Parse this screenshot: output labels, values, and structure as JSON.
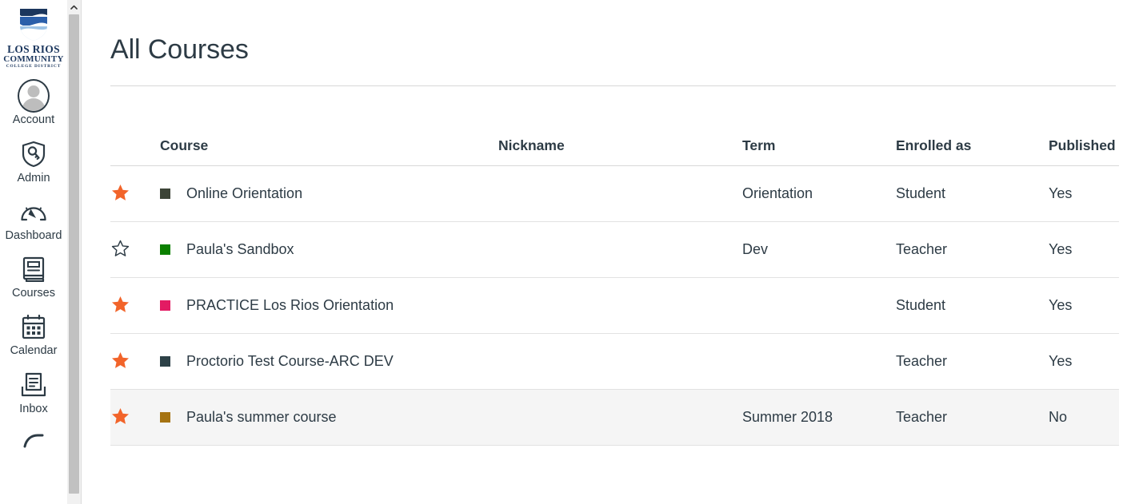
{
  "brand": {
    "logo_line1": "LOS RIOS",
    "logo_line2": "COMMUNITY",
    "logo_line3": "COLLEGE DISTRICT",
    "logo_color": "#1b365d"
  },
  "nav": {
    "items": [
      {
        "label": "Account",
        "icon": "account-avatar-icon"
      },
      {
        "label": "Admin",
        "icon": "shield-key-icon"
      },
      {
        "label": "Dashboard",
        "icon": "dashboard-gauge-icon"
      },
      {
        "label": "Courses",
        "icon": "book-icon"
      },
      {
        "label": "Calendar",
        "icon": "calendar-icon"
      },
      {
        "label": "Inbox",
        "icon": "inbox-tray-icon"
      }
    ]
  },
  "scrollbar": {
    "up_arrow_icon": "chevron-up-icon"
  },
  "page": {
    "title": "All Courses"
  },
  "table": {
    "columns": [
      "",
      "Course",
      "Nickname",
      "Term",
      "Enrolled as",
      "Published"
    ],
    "rows": [
      {
        "favorite": true,
        "star_icon": "star-filled-icon",
        "swatch_color": "#3c4437",
        "course": "Online Orientation",
        "nickname": "",
        "term": "Orientation",
        "enrolled_as": "Student",
        "published": "Yes",
        "published_state": "yes",
        "hover": false
      },
      {
        "favorite": false,
        "star_icon": "star-outline-icon",
        "swatch_color": "#0b8000",
        "course": "Paula's Sandbox",
        "nickname": "",
        "term": "Dev",
        "enrolled_as": "Teacher",
        "published": "Yes",
        "published_state": "yes",
        "hover": false
      },
      {
        "favorite": true,
        "star_icon": "star-filled-icon",
        "swatch_color": "#e31b63",
        "course": "PRACTICE Los Rios Orientation",
        "nickname": "",
        "term": "",
        "enrolled_as": "Student",
        "published": "Yes",
        "published_state": "yes",
        "hover": false
      },
      {
        "favorite": true,
        "star_icon": "star-filled-icon",
        "swatch_color": "#2d4147",
        "course": "Proctorio Test Course-ARC DEV",
        "nickname": "",
        "term": "",
        "enrolled_as": "Teacher",
        "published": "Yes",
        "published_state": "yes",
        "hover": false
      },
      {
        "favorite": true,
        "star_icon": "star-filled-icon",
        "swatch_color": "#a57312",
        "course": "Paula's summer course",
        "nickname": "",
        "term": "Summer 2018",
        "enrolled_as": "Teacher",
        "published": "No",
        "published_state": "no",
        "hover": true
      }
    ]
  },
  "colors": {
    "star_favorite": "#f2642a",
    "star_empty_stroke": "#2d3b45",
    "text": "#2d3b45",
    "published_no": "#e0661b",
    "row_hover_bg": "#f5f5f5",
    "divider": "#e2e2e2"
  }
}
